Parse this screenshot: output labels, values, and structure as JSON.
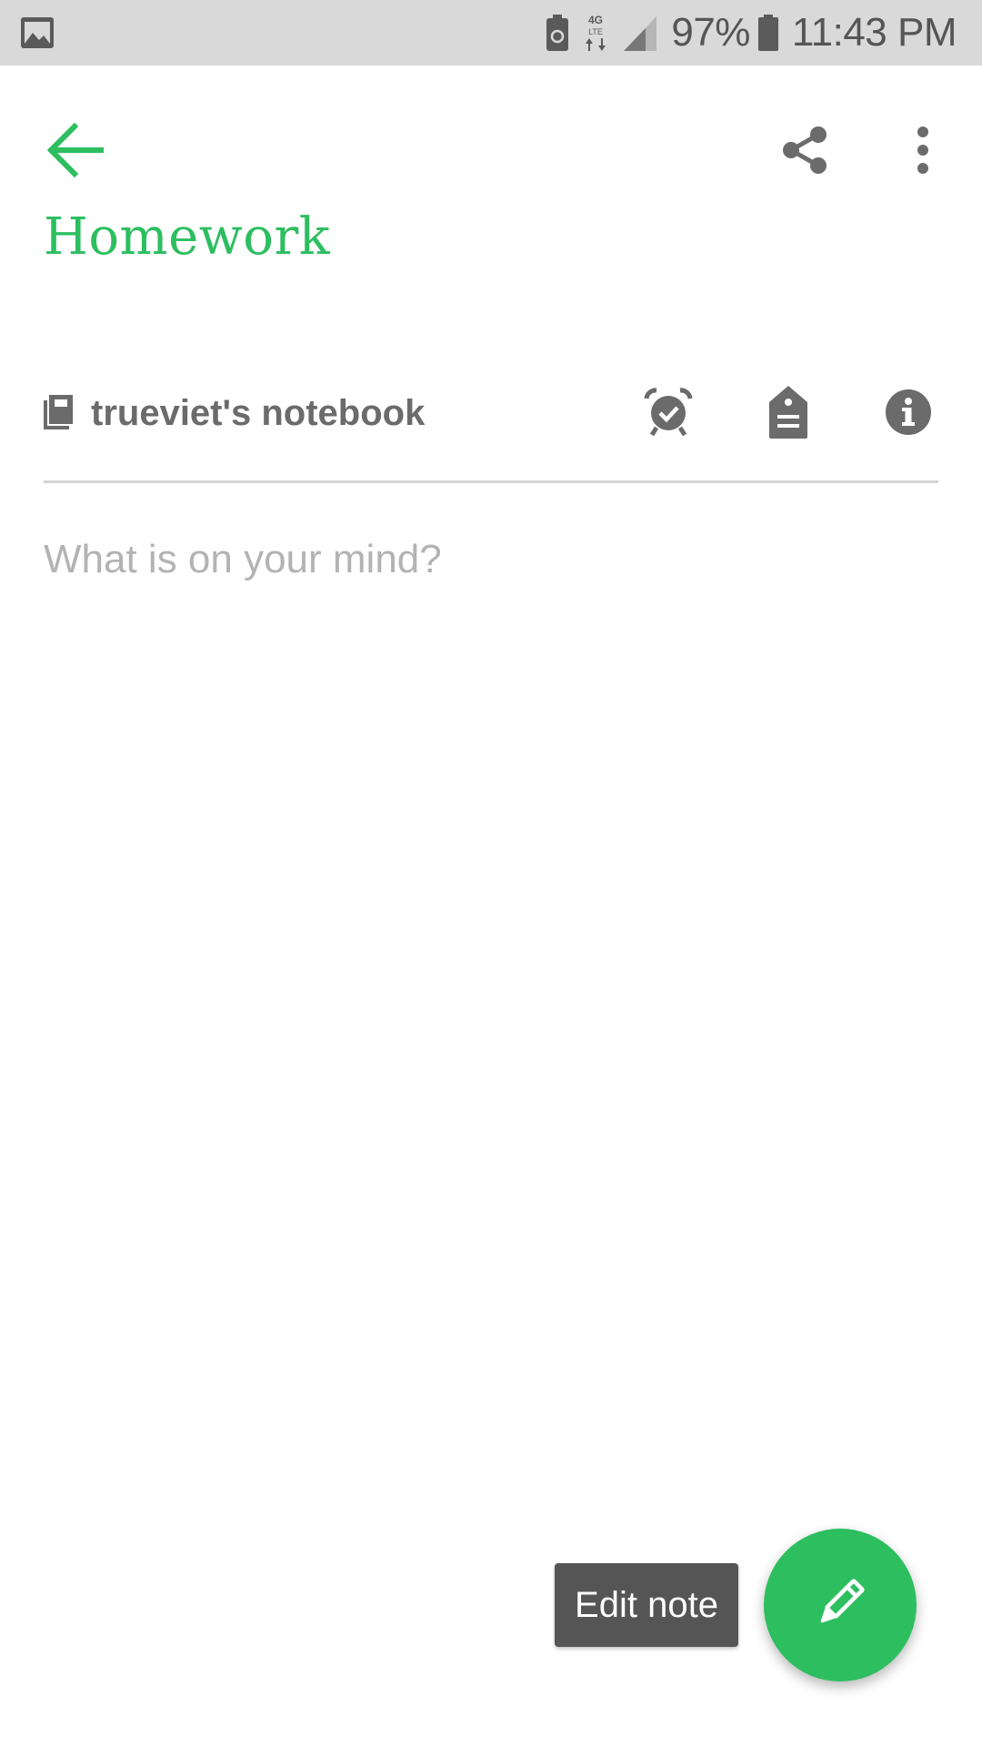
{
  "status_bar": {
    "battery_percent": "97%",
    "time": "11:43 PM",
    "icons": [
      "gallery-icon",
      "battery-saver-icon",
      "4g-lte-icon",
      "signal-icon",
      "battery-icon"
    ]
  },
  "toolbar": {
    "back_icon": "arrow-left-icon",
    "share_icon": "share-icon",
    "more_icon": "more-vert-icon"
  },
  "note": {
    "title": "Homework",
    "notebook_name": "trueviet's notebook",
    "body_placeholder": "What is on your mind?"
  },
  "note_actions": {
    "reminder_icon": "alarm-check-icon",
    "tag_icon": "tag-icon",
    "info_icon": "info-icon"
  },
  "fab": {
    "tooltip": "Edit note",
    "icon": "pencil-icon"
  },
  "colors": {
    "accent": "#2dbe60",
    "status_bar_bg": "#d9d9d9",
    "icon_gray": "#6b6b6b",
    "placeholder": "#b3b3b3",
    "tooltip_bg": "#555555"
  }
}
